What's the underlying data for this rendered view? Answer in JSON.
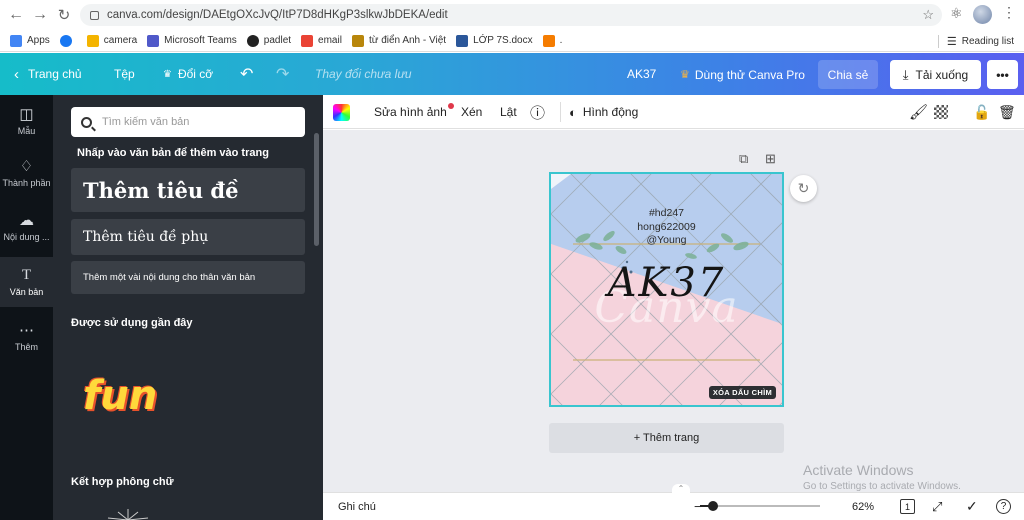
{
  "browser": {
    "url": "canva.com/design/DAEtgOXcJvQ/ItP7D8dHKgP3slkwJbDEKA/edit",
    "bookmarks": [
      {
        "label": "Apps",
        "color": "#4285f4"
      },
      {
        "label": "",
        "color": "#1877f2"
      },
      {
        "label": "camera",
        "color": "#f4b400"
      },
      {
        "label": "Microsoft Teams",
        "color": "#5059c9"
      },
      {
        "label": "padlet",
        "color": "#222222"
      },
      {
        "label": "email",
        "color": "#ea4335"
      },
      {
        "label": "từ điển Anh - Việt",
        "color": "#b8860b"
      },
      {
        "label": "LỚP 7S.docx",
        "color": "#2b579a"
      },
      {
        "label": ".",
        "color": "#f57c00"
      }
    ],
    "reading_list": "Reading list"
  },
  "topbar": {
    "home": "Trang chủ",
    "file": "Tệp",
    "resize": "Đổi cỡ",
    "status": "Thay đổi chưa lưu",
    "title": "AK37",
    "try_pro": "Dùng thử Canva Pro",
    "share": "Chia sẻ",
    "download": "Tải xuống",
    "more": "•••"
  },
  "rail": [
    {
      "label": "Mẫu",
      "icon": "template-icon"
    },
    {
      "label": "Thành phần",
      "icon": "elements-icon"
    },
    {
      "label": "Nội dung ...",
      "icon": "upload-icon"
    },
    {
      "label": "Văn bản",
      "icon": "text-icon",
      "active": true
    },
    {
      "label": "Thêm",
      "icon": "more-icon"
    }
  ],
  "panel": {
    "search_placeholder": "Tìm kiếm văn bản",
    "hint": "Nhấp vào văn bản để thêm vào trang",
    "heading": "Thêm tiêu đề",
    "subheading": "Thêm tiêu đề phụ",
    "body": "Thêm một vài nội dung cho thân văn bản",
    "recent": "Được sử dụng gần đây",
    "recent_sample": "fun",
    "combos": "Kết hợp phông chữ"
  },
  "editor_toolbar": {
    "edit_image": "Sửa hình ảnh",
    "crop": "Xén",
    "flip": "Lật",
    "animate": "Hình động"
  },
  "design": {
    "line1": "#hd247",
    "line2": "hong622009",
    "line3": "@Young",
    "title": "AK37",
    "canva_watermark": "Canva",
    "remove_watermark": "XÓA DẤU CHÌM"
  },
  "add_page": "+ Thêm trang",
  "windows_watermark": {
    "line1": "Activate Windows",
    "line2": "Go to Settings to activate Windows."
  },
  "bottom": {
    "notes": "Ghi chú",
    "zoom": "62%",
    "page_count": "1",
    "zoom_level": 0.62
  }
}
